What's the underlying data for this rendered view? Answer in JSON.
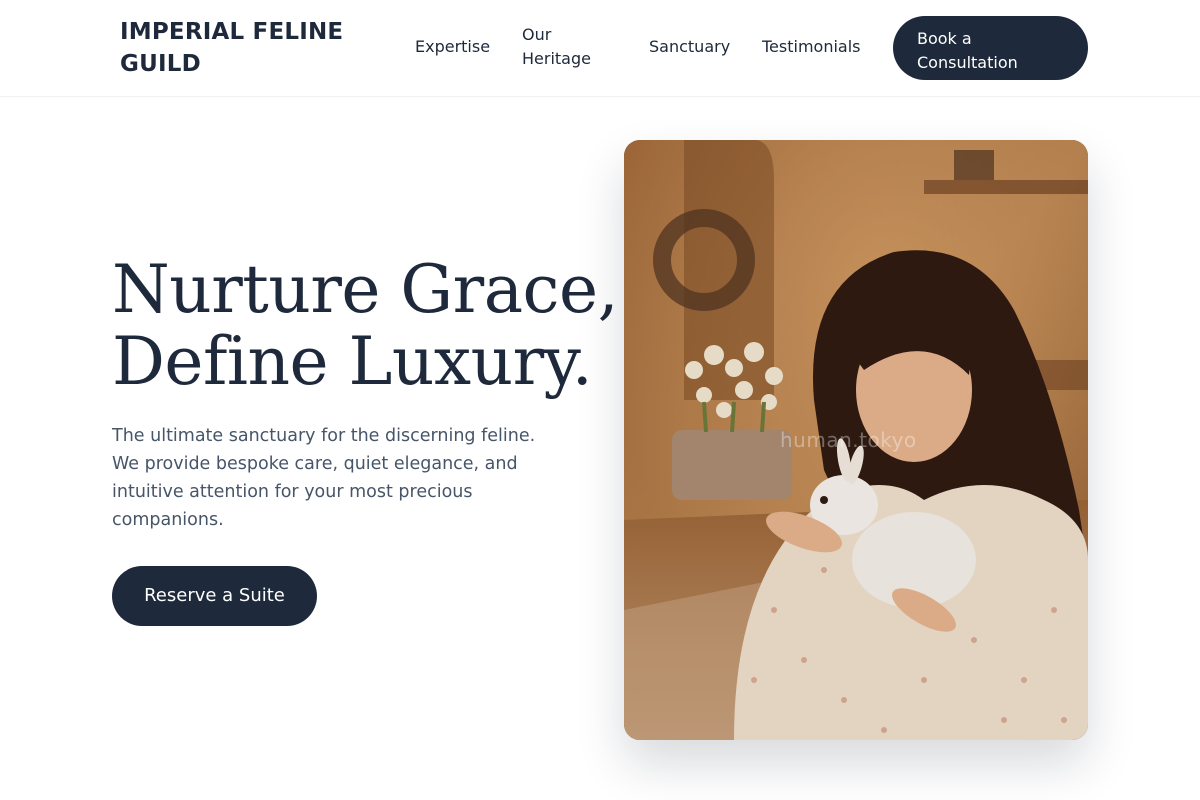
{
  "header": {
    "brand": "IMPERIAL FELINE GUILD",
    "nav": [
      {
        "label": "Expertise"
      },
      {
        "label": "Our Heritage"
      },
      {
        "label": "Sanctuary"
      },
      {
        "label": "Testimonials"
      }
    ],
    "cta_label": "Book a Consultation"
  },
  "hero": {
    "title_line1": "Nurture Grace,",
    "title_line2": "Define Luxury.",
    "description": "The ultimate sanctuary for the discerning feline. We provide bespoke care, quiet elegance, and intuitive attention for your most precious companions.",
    "cta_label": "Reserve a Suite",
    "image_watermark": "human.tokyo"
  },
  "colors": {
    "primary": "#1e293b",
    "text_muted": "#475569",
    "background": "#ffffff"
  }
}
